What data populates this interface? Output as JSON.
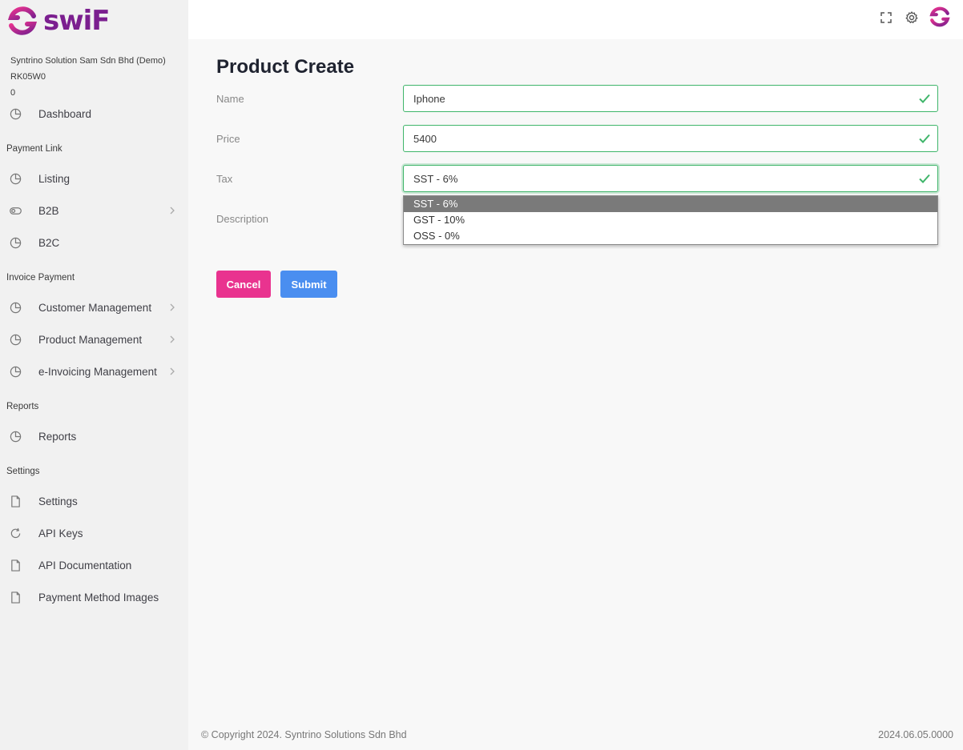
{
  "brand": {
    "logo_text": "swiF",
    "color": "#7b1f8f"
  },
  "company": {
    "name": "Syntrino Solution Sam Sdn Bhd (Demo)",
    "code": "RK05W0",
    "count": "0"
  },
  "sidebar": {
    "dashboard": "Dashboard",
    "sections": {
      "payment_link": "Payment Link",
      "invoice_payment": "Invoice Payment",
      "reports": "Reports",
      "settings": "Settings"
    },
    "payment_link_items": [
      {
        "label": "Listing",
        "icon": "pie-chart-icon"
      },
      {
        "label": "B2B",
        "icon": "toggle-icon"
      },
      {
        "label": "B2C",
        "icon": "pie-chart-icon"
      }
    ],
    "invoice_items": [
      {
        "label": "Customer Management",
        "icon": "pie-chart-icon"
      },
      {
        "label": "Product Management",
        "icon": "pie-chart-icon"
      },
      {
        "label": "e-Invoicing Management",
        "icon": "pie-chart-icon"
      }
    ],
    "reports_items": [
      {
        "label": "Reports",
        "icon": "pie-chart-icon"
      }
    ],
    "settings_items": [
      {
        "label": "Settings",
        "icon": "file-icon"
      },
      {
        "label": "API Keys",
        "icon": "refresh-icon"
      },
      {
        "label": "API Documentation",
        "icon": "file-icon"
      },
      {
        "label": "Payment Method Images",
        "icon": "file-icon"
      }
    ]
  },
  "page": {
    "title": "Product Create"
  },
  "form": {
    "name_label": "Name",
    "name_value": "Iphone",
    "price_label": "Price",
    "price_value": "5400",
    "tax_label": "Tax",
    "tax_value": "SST - 6%",
    "description_label": "Description",
    "tax_options": [
      "SST - 6%",
      "GST - 10%",
      "OSS - 0%"
    ],
    "cancel_label": "Cancel",
    "submit_label": "Submit"
  },
  "footer": {
    "copyright": "© Copyright 2024. Syntrino Solutions Sdn Bhd",
    "version": "2024.06.05.0000"
  },
  "colors": {
    "accent_pink": "#e9338f",
    "accent_blue": "#4a8ef0",
    "valid_green": "#3fb56a"
  }
}
